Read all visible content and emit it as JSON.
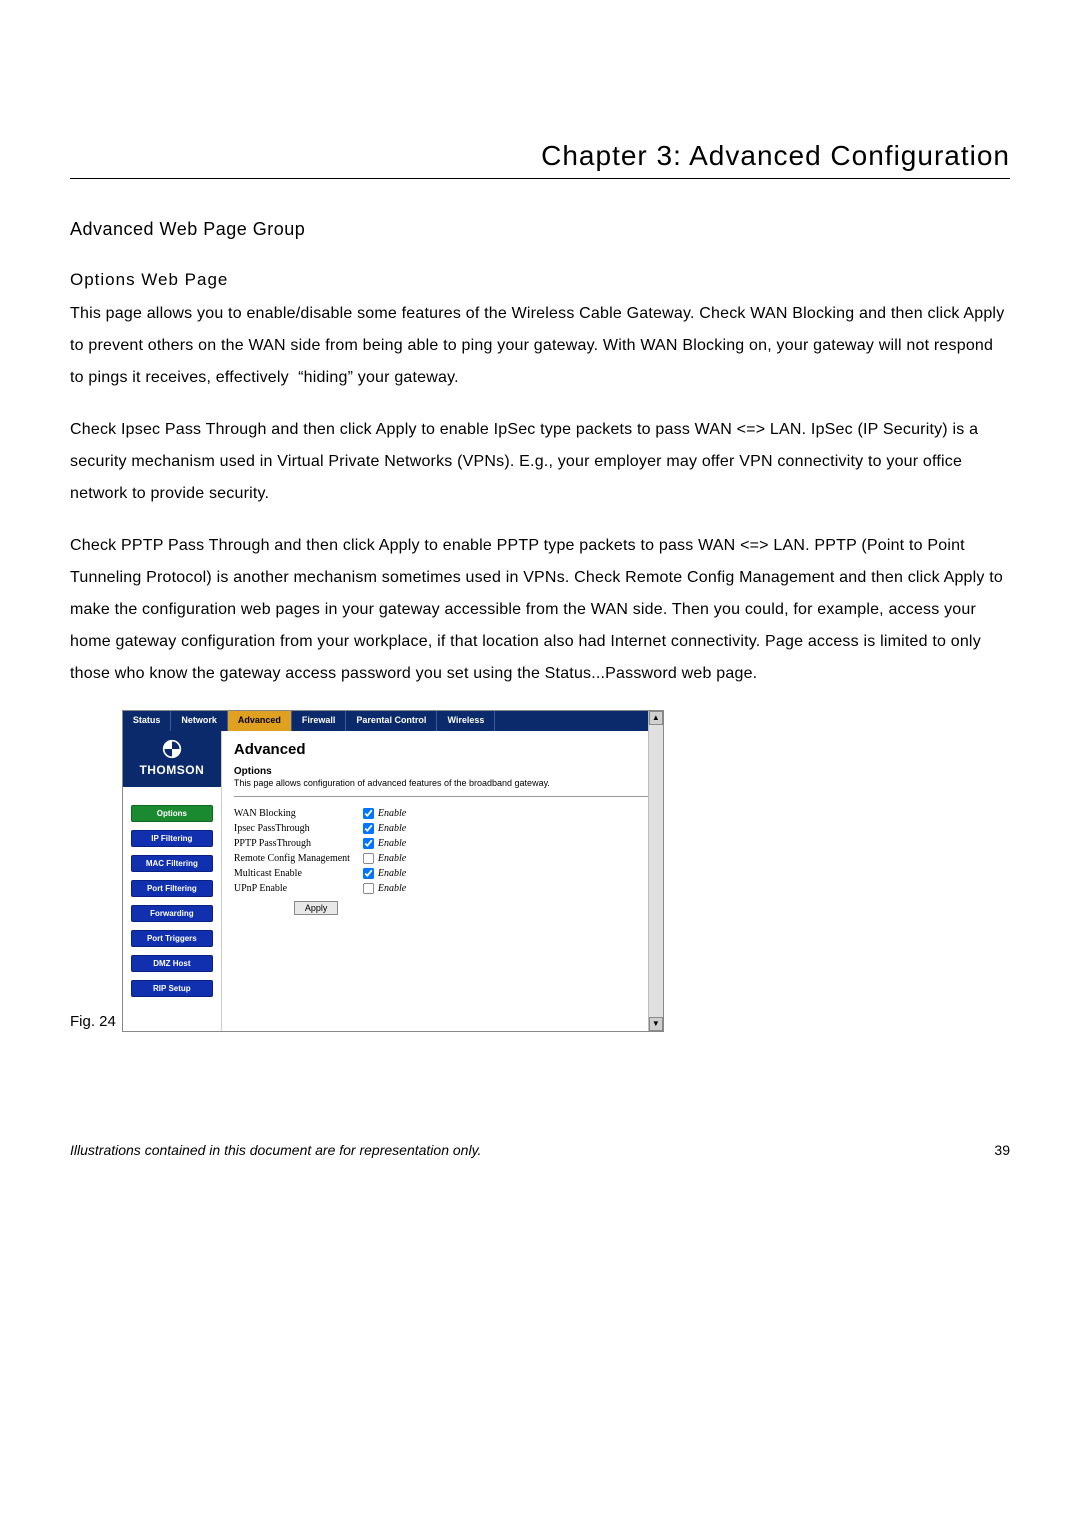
{
  "chapter_title": "Chapter 3: Advanced Configuration",
  "section_h2": "Advanced Web Page Group",
  "section_h3": "Options Web Page",
  "para1": "This page allows you to enable/disable some features of the Wireless Cable Gateway. Check WAN Blocking and then click Apply to prevent others on the WAN side from being able to ping your gateway. With WAN Blocking on, your gateway will not respond to pings it receives, effectively  “hiding” your gateway.",
  "para2": "Check Ipsec Pass Through and then click Apply to enable IpSec type packets to pass WAN <=> LAN. IpSec (IP Security) is a security mechanism used in Virtual Private Networks (VPNs). E.g., your employer may offer VPN connectivity to your office network to provide security.",
  "para3": "Check PPTP Pass Through and then click Apply to enable PPTP type packets to pass WAN <=> LAN. PPTP (Point to Point Tunneling Protocol) is another mechanism sometimes used in VPNs. Check Remote Config Management and then click Apply to make the configuration web pages in your gateway accessible from the WAN side. Then you could, for example, access your home gateway configuration from your workplace, if that location also had Internet connectivity. Page access is limited to only those who know the gateway access password you set using the Status...Password web page.",
  "fig_label": "Fig. 24",
  "screenshot": {
    "tabs": [
      "Status",
      "Network",
      "Advanced",
      "Firewall",
      "Parental Control",
      "Wireless"
    ],
    "active_tab_index": 2,
    "brand": "THOMSON",
    "side_buttons": [
      "Options",
      "IP Filtering",
      "MAC Filtering",
      "Port Filtering",
      "Forwarding",
      "Port Triggers",
      "DMZ Host",
      "RIP Setup"
    ],
    "active_side_index": 0,
    "panel_title": "Advanced",
    "panel_subtitle": "Options",
    "panel_desc": "This page allows configuration of advanced features of the broadband gateway.",
    "options": [
      {
        "label": "WAN Blocking",
        "checked": true
      },
      {
        "label": "Ipsec PassThrough",
        "checked": true
      },
      {
        "label": "PPTP PassThrough",
        "checked": true
      },
      {
        "label": "Remote Config Management",
        "checked": false
      },
      {
        "label": "Multicast Enable",
        "checked": true
      },
      {
        "label": "UPnP Enable",
        "checked": false
      }
    ],
    "enable_label": "Enable",
    "apply_label": "Apply"
  },
  "footer_note": "Illustrations contained in this document are for representation only.",
  "page_number": "39"
}
